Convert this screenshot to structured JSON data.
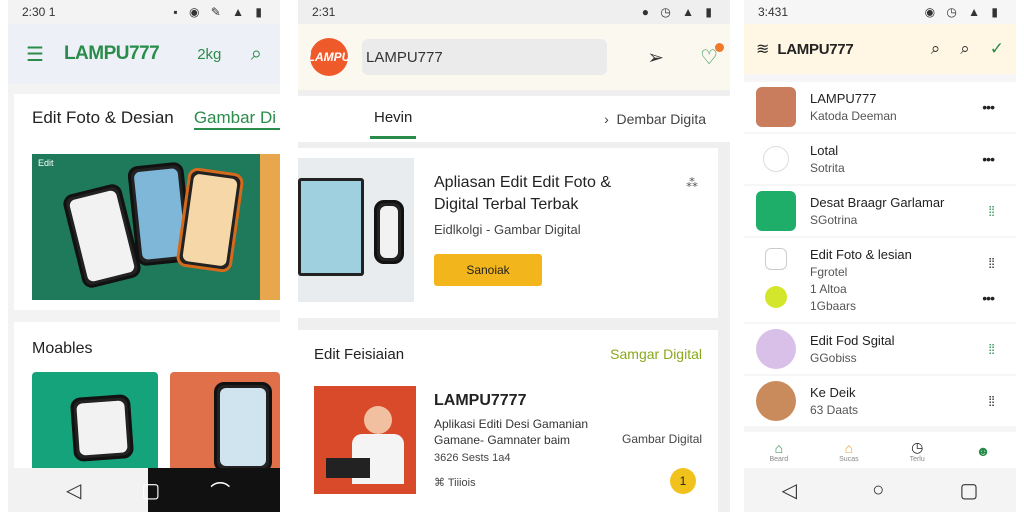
{
  "phone1": {
    "status": {
      "time": "2:30 1",
      "icons": "▪ ◉ ✎ ▲ ▮"
    },
    "appbar": {
      "menu_icon": "menu-icon",
      "logo": "LAMPU777",
      "count": "2kg",
      "search_icon": "search-icon"
    },
    "section1": {
      "title": "Edit Foto & Desian",
      "link": "Gambar Di",
      "banner_tiny": "Edit"
    },
    "section2": {
      "title": "Moables"
    },
    "navbar": [
      "◁",
      "▢",
      "⌒"
    ]
  },
  "phone2": {
    "status": {
      "time": "2:31",
      "icons": "● ◷ ▲ ▮"
    },
    "appbar": {
      "logo": "LAMPU",
      "search_value": "LAMPU777",
      "send_icon": "send-icon",
      "heart_icon": "heart-icon"
    },
    "tabs": {
      "home": "Hevin",
      "right": "Dembar Digita"
    },
    "card1": {
      "title": "Apliasan Edit Edit Foto & Digital Terbal Terbak",
      "subtitle": "Eidlkolgi - Gambar Digital",
      "button": "Sanoiak",
      "icon": "⁂"
    },
    "card2": {
      "header": "Edit Feisiaian",
      "link": "Samgar Digital",
      "title": "LAMPU7777",
      "desc": "Aplikasi Editi Desi Gamanian Gamane- Gamnater baim",
      "right": "Gambar Digital",
      "meta": "3626 Sests 1a4",
      "foot": "Tiiiois",
      "badge": "1"
    }
  },
  "phone3": {
    "status": {
      "time": "3:431",
      "icons": "◉ ◷ ▲ ▮"
    },
    "appbar": {
      "logo": "LAMPU777",
      "icons": [
        "⌕",
        "⌕",
        "✓"
      ]
    },
    "items": [
      {
        "title": "LAMPU777",
        "sub": "Katoda Deeman",
        "extra": "",
        "avatar": "#c97d5c",
        "dots_color": "dark"
      },
      {
        "title": "Lotal",
        "sub": "Sotrita",
        "extra": "",
        "avatar": "#ffffff",
        "dots_color": "dark"
      },
      {
        "title": "Desat Braagr Garlamar",
        "sub": "SGotrina",
        "extra": "",
        "avatar": "#1fae6a",
        "dots_color": "green"
      },
      {
        "title": "Edit Foto & lesian",
        "sub": "Fgrotel",
        "extra": "1 Altoa",
        "extra2": "1Gbaars",
        "avatar": "#f3f3f3",
        "dots_color": "dark"
      },
      {
        "title": "Edit Fod Sgital",
        "sub": "GGobiss",
        "extra": "",
        "avatar": "#d8c0e8",
        "dots_color": "green"
      },
      {
        "title": "Ke Deik",
        "sub": "63 Daats",
        "extra": "",
        "avatar": "#c98a5c",
        "dots_color": "dark"
      }
    ],
    "bottom_nav": [
      {
        "icon": "⌂",
        "label": "Beard",
        "color": "#2a8c4a"
      },
      {
        "icon": "⌂",
        "label": "Sucas",
        "color": "#e6a02b"
      },
      {
        "icon": "◷",
        "label": "Terlu",
        "color": "#333"
      },
      {
        "icon": "☻",
        "label": "",
        "color": "#2a8c4a"
      }
    ],
    "navbar": [
      "◁",
      "○",
      "▢"
    ]
  }
}
